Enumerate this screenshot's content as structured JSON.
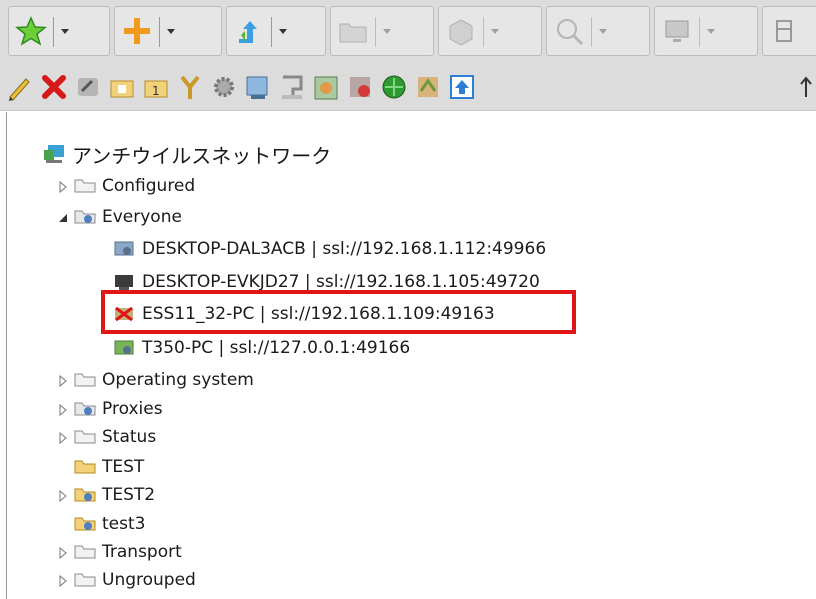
{
  "toolbar": {
    "buttons": [
      {
        "icon": "star-icon",
        "disabled": false
      },
      {
        "icon": "add-icon",
        "disabled": false
      },
      {
        "icon": "move-icon",
        "disabled": false
      },
      {
        "icon": "folder-icon",
        "disabled": true
      },
      {
        "icon": "box-icon",
        "disabled": true
      },
      {
        "icon": "search-icon",
        "disabled": true
      },
      {
        "icon": "monitor-icon",
        "disabled": true
      }
    ],
    "actions": [
      "edit-icon",
      "delete-icon",
      "clear-icon",
      "group-icon",
      "group-one-icon",
      "filter-icon",
      "settings-icon",
      "note-icon",
      "console-icon",
      "scan-icon",
      "protect-icon",
      "shield-icon",
      "sync-icon",
      "upload-icon"
    ]
  },
  "tree": {
    "root": "アンチウイルスネットワーク",
    "items": [
      {
        "label": "Configured",
        "kind": "folder",
        "expander": "closed"
      },
      {
        "label": "Everyone",
        "kind": "group",
        "expander": "open"
      },
      {
        "label": "DESKTOP-DAL3ACB | ssl://192.168.1.112:49966",
        "kind": "station"
      },
      {
        "label": "DESKTOP-EVKJD27 | ssl://192.168.1.105:49720",
        "kind": "station-dark"
      },
      {
        "label": "ESS11_32-PC | ssl://192.168.1.109:49163",
        "kind": "station-error"
      },
      {
        "label": "T350-PC | ssl://127.0.0.1:49166",
        "kind": "station-ok"
      },
      {
        "label": "Operating system",
        "kind": "folder",
        "expander": "closed"
      },
      {
        "label": "Proxies",
        "kind": "group",
        "expander": "closed"
      },
      {
        "label": "Status",
        "kind": "folder",
        "expander": "closed"
      },
      {
        "label": "TEST",
        "kind": "folder-yellow",
        "expander": "none"
      },
      {
        "label": "TEST2",
        "kind": "group-yellow",
        "expander": "closed"
      },
      {
        "label": "test3",
        "kind": "group-yellow",
        "expander": "none"
      },
      {
        "label": "Transport",
        "kind": "folder",
        "expander": "closed"
      },
      {
        "label": "Ungrouped",
        "kind": "folder",
        "expander": "closed"
      }
    ]
  },
  "highlight_color": "#e01515"
}
